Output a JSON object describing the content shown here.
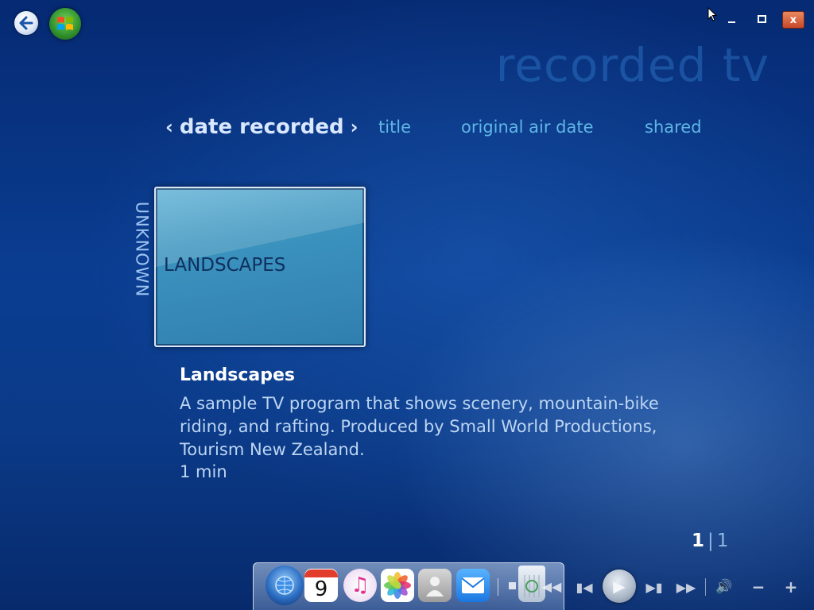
{
  "header": {
    "page_title": "recorded tv"
  },
  "window_controls": {
    "minimize_icon": "minimize-icon",
    "restore_icon": "restore-icon",
    "close_label": "x"
  },
  "sort_tabs": {
    "active": "date recorded",
    "title": "title",
    "original_air_date": "original air date",
    "shared": "shared"
  },
  "group": {
    "label": "UNKNOWN"
  },
  "tile": {
    "label": "LANDSCAPES"
  },
  "details": {
    "title": "Landscapes",
    "description": "A sample TV program that shows scenery, mountain-bike riding, and rafting. Produced by Small World Productions, Tourism New Zealand.",
    "duration": "1 min"
  },
  "pager": {
    "current": "1",
    "total": "1"
  },
  "dock": {
    "calendar_day": "9",
    "items": [
      "finder-icon",
      "calendar-icon",
      "music-icon",
      "photos-icon",
      "contacts-icon",
      "mail-icon",
      "trash-icon"
    ]
  },
  "playback": {
    "icons": [
      "rewind-icon",
      "previous-icon",
      "play-icon",
      "next-icon",
      "fast-forward-icon",
      "volume-icon",
      "volume-down-icon",
      "volume-up-icon"
    ]
  },
  "colors": {
    "background": "#0a3d91",
    "tab_inactive": "#5fb6e6",
    "tile": "#3b93be",
    "close_button": "#c8472a"
  }
}
